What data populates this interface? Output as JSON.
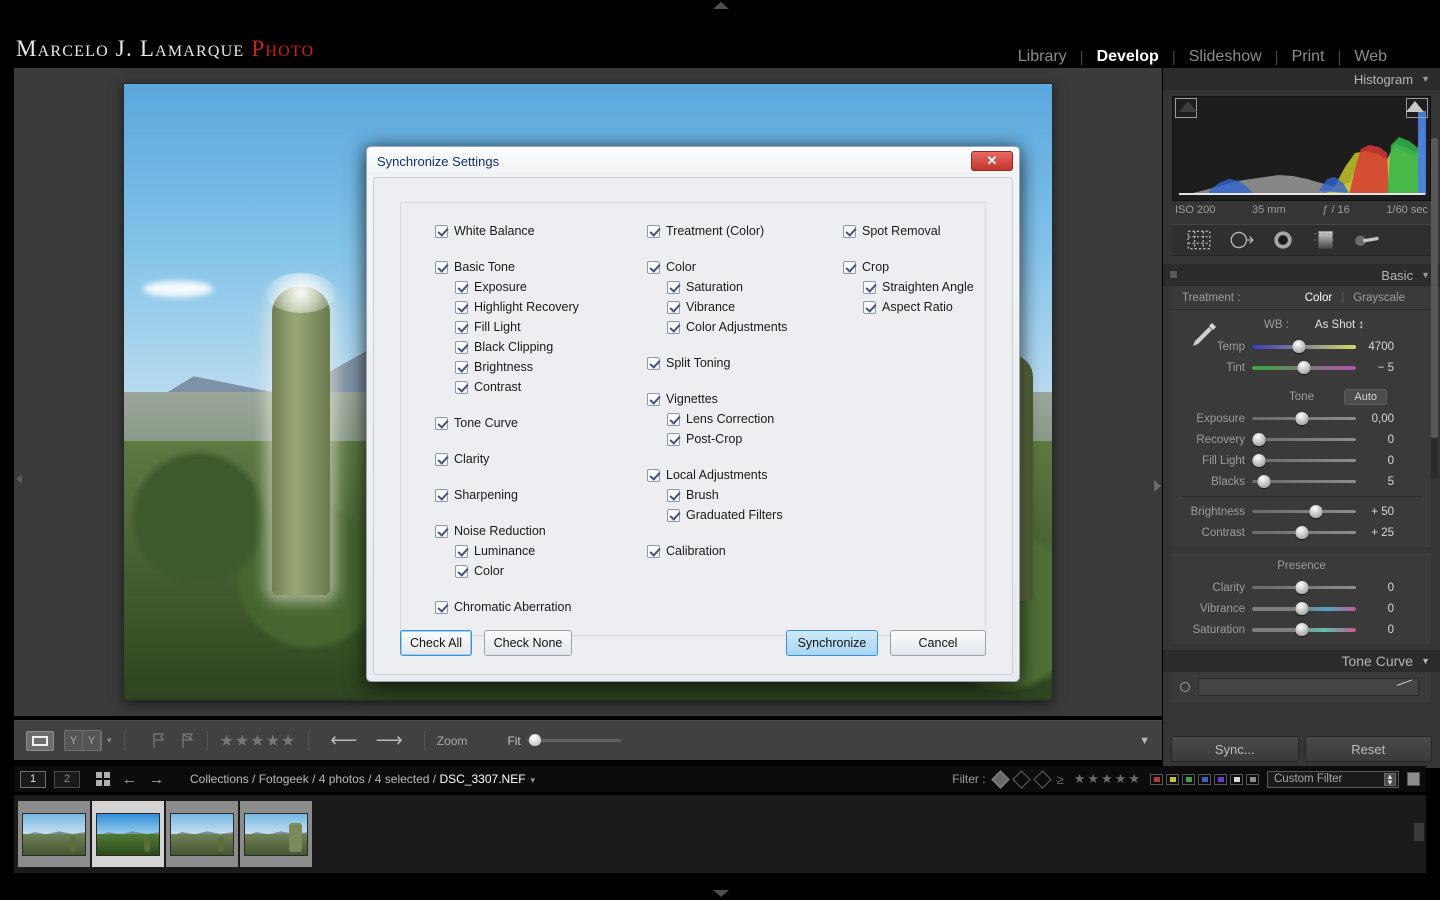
{
  "app": {
    "logo_main": "Marcelo J. Lamarque",
    "logo_accent": "Photo",
    "accent_color": "#c9211b"
  },
  "module_nav": {
    "items": [
      {
        "label": "Library",
        "active": false
      },
      {
        "label": "Develop",
        "active": true
      },
      {
        "label": "Slideshow",
        "active": false
      },
      {
        "label": "Print",
        "active": false
      },
      {
        "label": "Web",
        "active": false
      }
    ],
    "separator": "|"
  },
  "right_panel": {
    "histogram": {
      "title": "Histogram",
      "caret": "▼",
      "iso": "ISO 200",
      "focal": "35 mm",
      "aperture": "ƒ / 16",
      "shutter": "1/60 sec"
    },
    "tools": [
      "crop-overlay-icon",
      "spot-removal-icon",
      "red-eye-icon",
      "graduated-filter-icon",
      "adjustment-brush-icon"
    ],
    "basic": {
      "title": "Basic",
      "caret": "▼",
      "treatment_label": "Treatment :",
      "treatment_color": "Color",
      "treatment_grayscale": "Grayscale",
      "treatment_sep": "|",
      "wb_label": "WB :",
      "wb_value": "As Shot ↕",
      "wb_sliders": [
        {
          "name": "Temp",
          "value": "4700",
          "pos": 45
        },
        {
          "name": "Tint",
          "value": "− 5",
          "pos": 50
        }
      ],
      "tone_label": "Tone",
      "auto_label": "Auto",
      "tone_sliders": [
        {
          "name": "Exposure",
          "value": "0,00",
          "pos": 48
        },
        {
          "name": "Recovery",
          "value": "0",
          "pos": 7
        },
        {
          "name": "Fill Light",
          "value": "0",
          "pos": 7
        },
        {
          "name": "Blacks",
          "value": "5",
          "pos": 12
        }
      ],
      "tone_sliders2": [
        {
          "name": "Brightness",
          "value": "+ 50",
          "pos": 62
        },
        {
          "name": "Contrast",
          "value": "+ 25",
          "pos": 48
        }
      ],
      "presence_label": "Presence",
      "presence_sliders": [
        {
          "name": "Clarity",
          "value": "0",
          "pos": 48
        },
        {
          "name": "Vibrance",
          "value": "0",
          "pos": 48
        },
        {
          "name": "Saturation",
          "value": "0",
          "pos": 48
        }
      ]
    },
    "tone_curve": {
      "title": "Tone Curve",
      "caret": "▼"
    },
    "footer": {
      "sync_label": "Sync...",
      "reset_label": "Reset"
    }
  },
  "center_toolbar": {
    "view_icon": "loupe-view-icon",
    "compare_left": "Y",
    "compare_right": "Y",
    "caret": "▾",
    "stars": "★★★★★",
    "prev_arrow": "⟵",
    "next_arrow": "⟶",
    "zoom_label": "Zoom",
    "fit_label": "Fit",
    "toolbar_caret": "▼"
  },
  "filmstrip_bar": {
    "source_1": "1",
    "source_2": "2",
    "grid_icon": "grid-view-icon",
    "back_arrow": "←",
    "forward_arrow": "→",
    "breadcrumb_path": "Collections / Fotogeek / 4 photos / 4 selected / ",
    "breadcrumb_file": "DSC_3307.NEF",
    "breadcrumb_caret": "▾",
    "filter_label": "Filter :",
    "filter_stars": "★★★★★",
    "filter_compare": "≥",
    "color_swatches": [
      "#b03a3a",
      "#c9c03a",
      "#3ea34a",
      "#3a5fc9",
      "#6a3ac9",
      "#d8d8d8",
      "#8d8d8d"
    ],
    "custom_filter_value": "Custom Filter"
  },
  "filmstrip": {
    "thumbnails": [
      {
        "name": "thumbnail-1",
        "selected": false,
        "vivid": false,
        "big_cactus": false
      },
      {
        "name": "thumbnail-2",
        "selected": true,
        "vivid": true,
        "big_cactus": false
      },
      {
        "name": "thumbnail-3",
        "selected": false,
        "vivid": false,
        "big_cactus": false
      },
      {
        "name": "thumbnail-4",
        "selected": false,
        "vivid": false,
        "big_cactus": true
      }
    ]
  },
  "dialog": {
    "title": "Synchronize Settings",
    "close_label": "✕",
    "columns": [
      {
        "name": "column-1",
        "items": [
          {
            "label": "White Balance",
            "checked": true,
            "sub": false,
            "gap": false
          },
          {
            "label": "Basic Tone",
            "checked": true,
            "sub": false,
            "gap": true
          },
          {
            "label": "Exposure",
            "checked": true,
            "sub": true,
            "gap": false
          },
          {
            "label": "Highlight Recovery",
            "checked": true,
            "sub": true,
            "gap": false
          },
          {
            "label": "Fill Light",
            "checked": true,
            "sub": true,
            "gap": false
          },
          {
            "label": "Black Clipping",
            "checked": true,
            "sub": true,
            "gap": false
          },
          {
            "label": "Brightness",
            "checked": true,
            "sub": true,
            "gap": false
          },
          {
            "label": "Contrast",
            "checked": true,
            "sub": true,
            "gap": false
          },
          {
            "label": "Tone Curve",
            "checked": true,
            "sub": false,
            "gap": true
          },
          {
            "label": "Clarity",
            "checked": true,
            "sub": false,
            "gap": true
          },
          {
            "label": "Sharpening",
            "checked": true,
            "sub": false,
            "gap": true
          },
          {
            "label": "Noise Reduction",
            "checked": true,
            "sub": false,
            "gap": true
          },
          {
            "label": "Luminance",
            "checked": true,
            "sub": true,
            "gap": false
          },
          {
            "label": "Color",
            "checked": true,
            "sub": true,
            "gap": false
          },
          {
            "label": "Chromatic Aberration",
            "checked": true,
            "sub": false,
            "gap": true
          }
        ]
      },
      {
        "name": "column-2",
        "items": [
          {
            "label": "Treatment (Color)",
            "checked": true,
            "sub": false,
            "gap": false
          },
          {
            "label": "Color",
            "checked": true,
            "sub": false,
            "gap": true
          },
          {
            "label": "Saturation",
            "checked": true,
            "sub": true,
            "gap": false
          },
          {
            "label": "Vibrance",
            "checked": true,
            "sub": true,
            "gap": false
          },
          {
            "label": "Color Adjustments",
            "checked": true,
            "sub": true,
            "gap": false
          },
          {
            "label": "Split Toning",
            "checked": true,
            "sub": false,
            "gap": true
          },
          {
            "label": "Vignettes",
            "checked": true,
            "sub": false,
            "gap": true
          },
          {
            "label": "Lens Correction",
            "checked": true,
            "sub": true,
            "gap": false
          },
          {
            "label": "Post-Crop",
            "checked": true,
            "sub": true,
            "gap": false
          },
          {
            "label": "Local Adjustments",
            "checked": true,
            "sub": false,
            "gap": true
          },
          {
            "label": "Brush",
            "checked": true,
            "sub": true,
            "gap": false
          },
          {
            "label": "Graduated Filters",
            "checked": true,
            "sub": true,
            "gap": false
          },
          {
            "label": "Calibration",
            "checked": true,
            "sub": false,
            "gap": true
          }
        ]
      },
      {
        "name": "column-3",
        "items": [
          {
            "label": "Spot Removal",
            "checked": true,
            "sub": false,
            "gap": false
          },
          {
            "label": "Crop",
            "checked": true,
            "sub": false,
            "gap": true
          },
          {
            "label": "Straighten Angle",
            "checked": true,
            "sub": true,
            "gap": false
          },
          {
            "label": "Aspect Ratio",
            "checked": true,
            "sub": true,
            "gap": false
          }
        ]
      }
    ],
    "buttons": {
      "check_all": "Check All",
      "check_none": "Check None",
      "synchronize": "Synchronize",
      "cancel": "Cancel"
    }
  }
}
